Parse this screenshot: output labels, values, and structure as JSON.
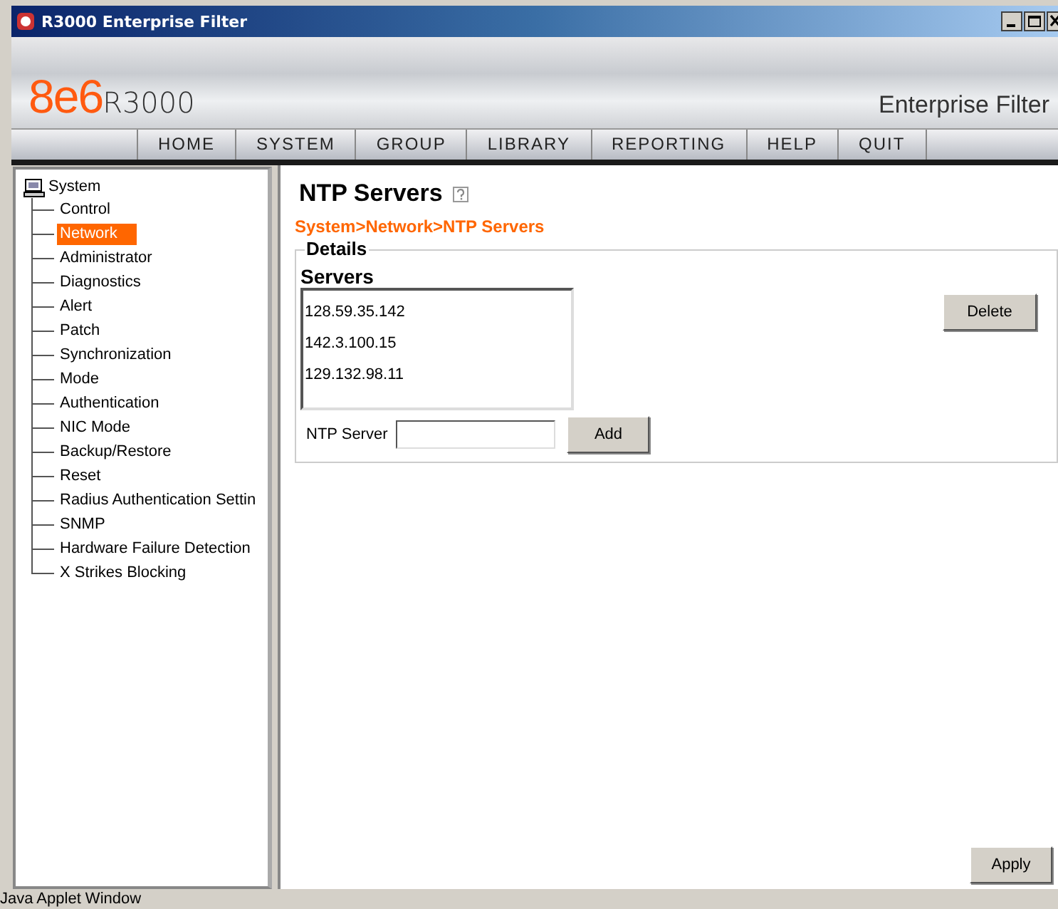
{
  "window": {
    "title": "R3000 Enterprise Filter"
  },
  "header": {
    "logo_brand": "8e6",
    "logo_product": "R3000",
    "tagline": "Enterprise Filter"
  },
  "nav": [
    {
      "label": "HOME"
    },
    {
      "label": "SYSTEM"
    },
    {
      "label": "GROUP"
    },
    {
      "label": "LIBRARY"
    },
    {
      "label": "REPORTING"
    },
    {
      "label": "HELP"
    },
    {
      "label": "QUIT"
    }
  ],
  "tree": [
    {
      "label": "System",
      "selected": false,
      "children": [
        {
          "label": "Control",
          "selected": false
        },
        {
          "label": "Network",
          "selected": true
        },
        {
          "label": "Administrator",
          "selected": false
        },
        {
          "label": "Diagnostics",
          "selected": false
        },
        {
          "label": "Alert",
          "selected": false
        },
        {
          "label": "Patch",
          "selected": false
        },
        {
          "label": "Synchronization",
          "selected": false
        },
        {
          "label": "Mode",
          "selected": false
        },
        {
          "label": "Authentication",
          "selected": false
        },
        {
          "label": "NIC Mode",
          "selected": false
        },
        {
          "label": "Backup/Restore",
          "selected": false
        },
        {
          "label": "Reset",
          "selected": false
        },
        {
          "label": "Radius Authentication Settin",
          "selected": false
        },
        {
          "label": "SNMP",
          "selected": false
        },
        {
          "label": "Hardware Failure Detection",
          "selected": false
        },
        {
          "label": "X Strikes Blocking",
          "selected": false
        }
      ]
    }
  ],
  "page": {
    "title": "NTP Servers",
    "breadcrumb": "System>Network>NTP Servers",
    "group_title": "Details",
    "list_label": "Servers",
    "servers": [
      {
        "address": "128.59.35.142",
        "selected": false
      },
      {
        "address": "142.3.100.15",
        "selected": false
      },
      {
        "address": "129.132.98.11",
        "selected": false
      }
    ],
    "delete_button": "Delete",
    "field_label": "NTP Server",
    "add_button": "Add",
    "apply_button": "Apply"
  },
  "status_bar": "Java Applet Window"
}
